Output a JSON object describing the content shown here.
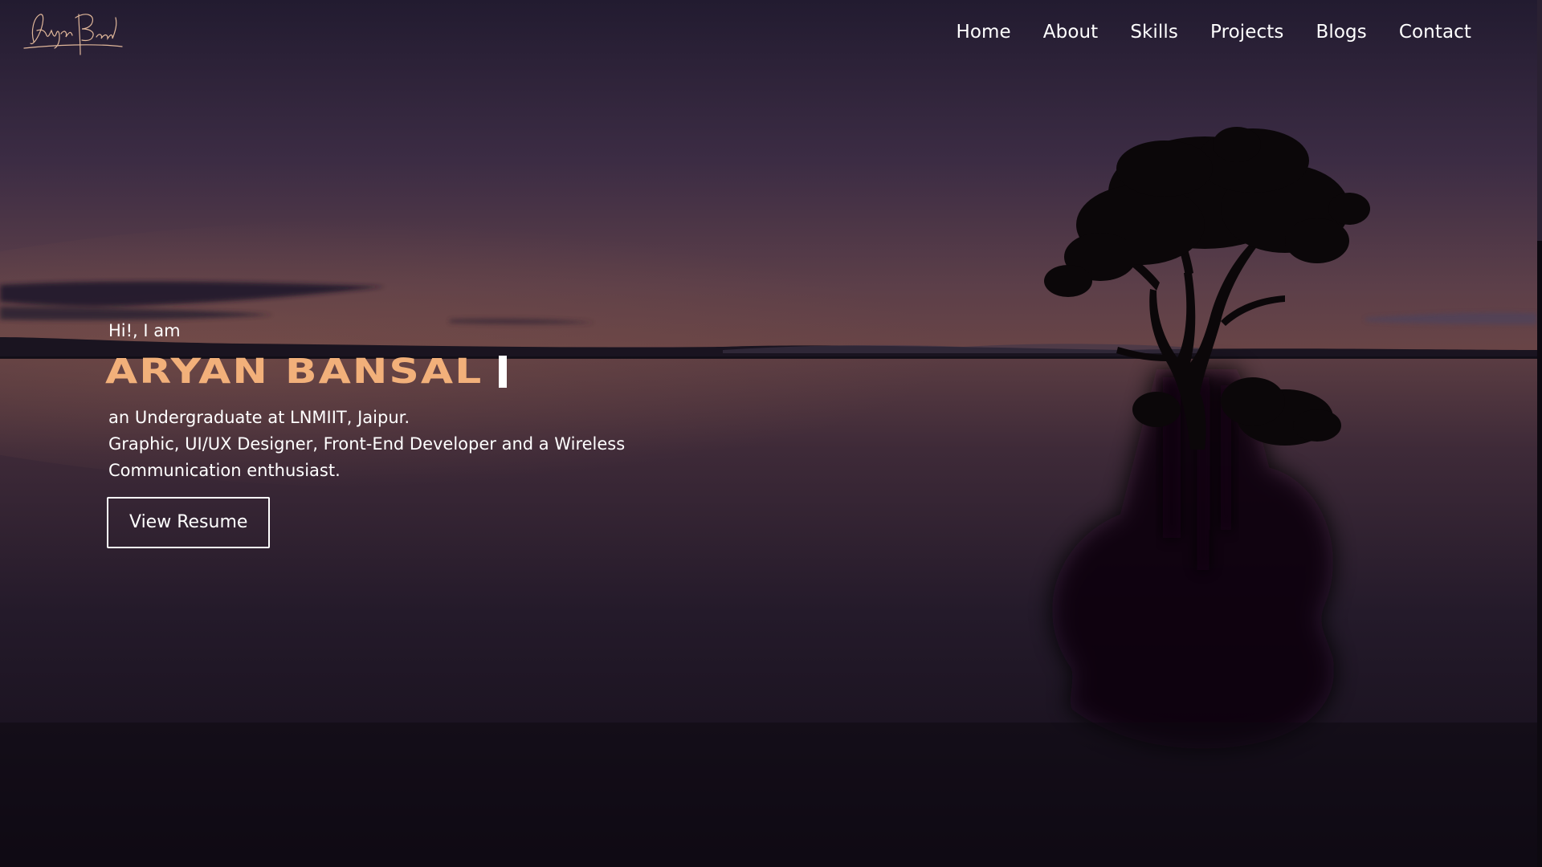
{
  "logo": {
    "alt": "Aryan Bansal signature",
    "color": "#e0b79a"
  },
  "nav": {
    "items": [
      {
        "label": "Home"
      },
      {
        "label": "About"
      },
      {
        "label": "Skills"
      },
      {
        "label": "Projects"
      },
      {
        "label": "Blogs"
      },
      {
        "label": "Contact"
      }
    ]
  },
  "hero": {
    "greeting": "Hi!, I am",
    "name": "ARYAN BANSAL",
    "line1": "an Undergraduate at LNMIIT, Jaipur.",
    "line2": "Graphic, UI/UX Designer, Front-End Developer and a Wireless",
    "line3": "Communication enthusiast.",
    "button_label": "View Resume"
  },
  "colors": {
    "accent": "#f2b07a",
    "text": "#ffffff",
    "sky_top": "#2c2338",
    "horizon": "#5a3e44",
    "water_bottom": "#100b14"
  }
}
